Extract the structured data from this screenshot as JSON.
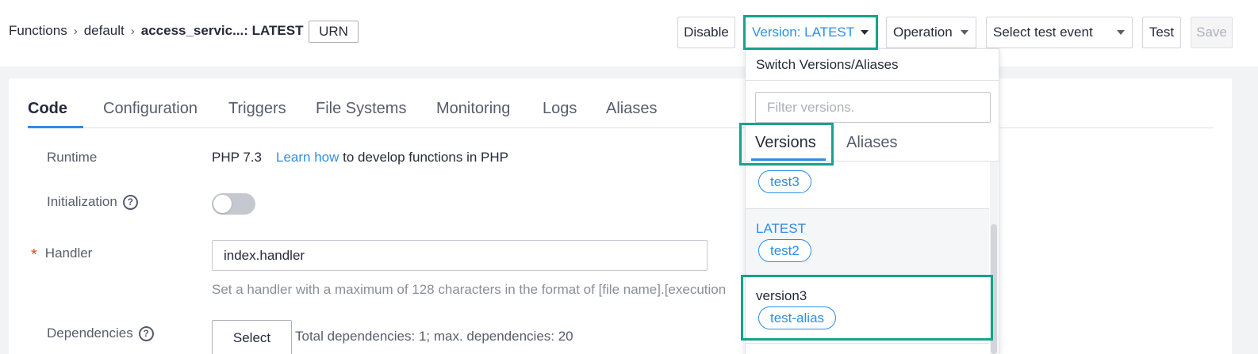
{
  "breadcrumb": {
    "items": [
      "Functions",
      "default"
    ],
    "separator": "›",
    "current": "access_servic...: LATEST"
  },
  "header": {
    "urn_label": "URN",
    "disable_label": "Disable",
    "version_label": "Version: LATEST",
    "operation_label": "Operation",
    "event_label": "Select test event",
    "test_label": "Test",
    "save_label": "Save"
  },
  "tabs": [
    "Code",
    "Configuration",
    "Triggers",
    "File Systems",
    "Monitoring",
    "Logs",
    "Aliases"
  ],
  "form": {
    "runtime_label": "Runtime",
    "runtime_value": "PHP 7.3",
    "runtime_link": "Learn how",
    "runtime_suffix": " to develop functions in PHP",
    "initialization_label": "Initialization",
    "initialization_enabled": false,
    "handler_required_mark": "*",
    "handler_label": "Handler",
    "handler_value": "index.handler",
    "handler_hint": "Set a handler with a maximum of 128 characters in the format of [file name].[execution",
    "dependencies_label": "Dependencies",
    "select_label": "Select",
    "dependencies_info": "Total dependencies: 1; max. dependencies: 20"
  },
  "dropdown": {
    "title": "Switch Versions/Aliases",
    "filter_placeholder": "Filter versions.",
    "tabs": [
      "Versions",
      "Aliases"
    ],
    "active_tab": "Versions",
    "items": [
      {
        "name": "",
        "alias": "test3"
      },
      {
        "name": "LATEST",
        "alias": "test2"
      },
      {
        "name": "version3",
        "alias": "test-alias"
      }
    ]
  },
  "colors": {
    "accent": "#2d8ee8",
    "highlight": "#15a38b",
    "required": "#e4432b"
  }
}
